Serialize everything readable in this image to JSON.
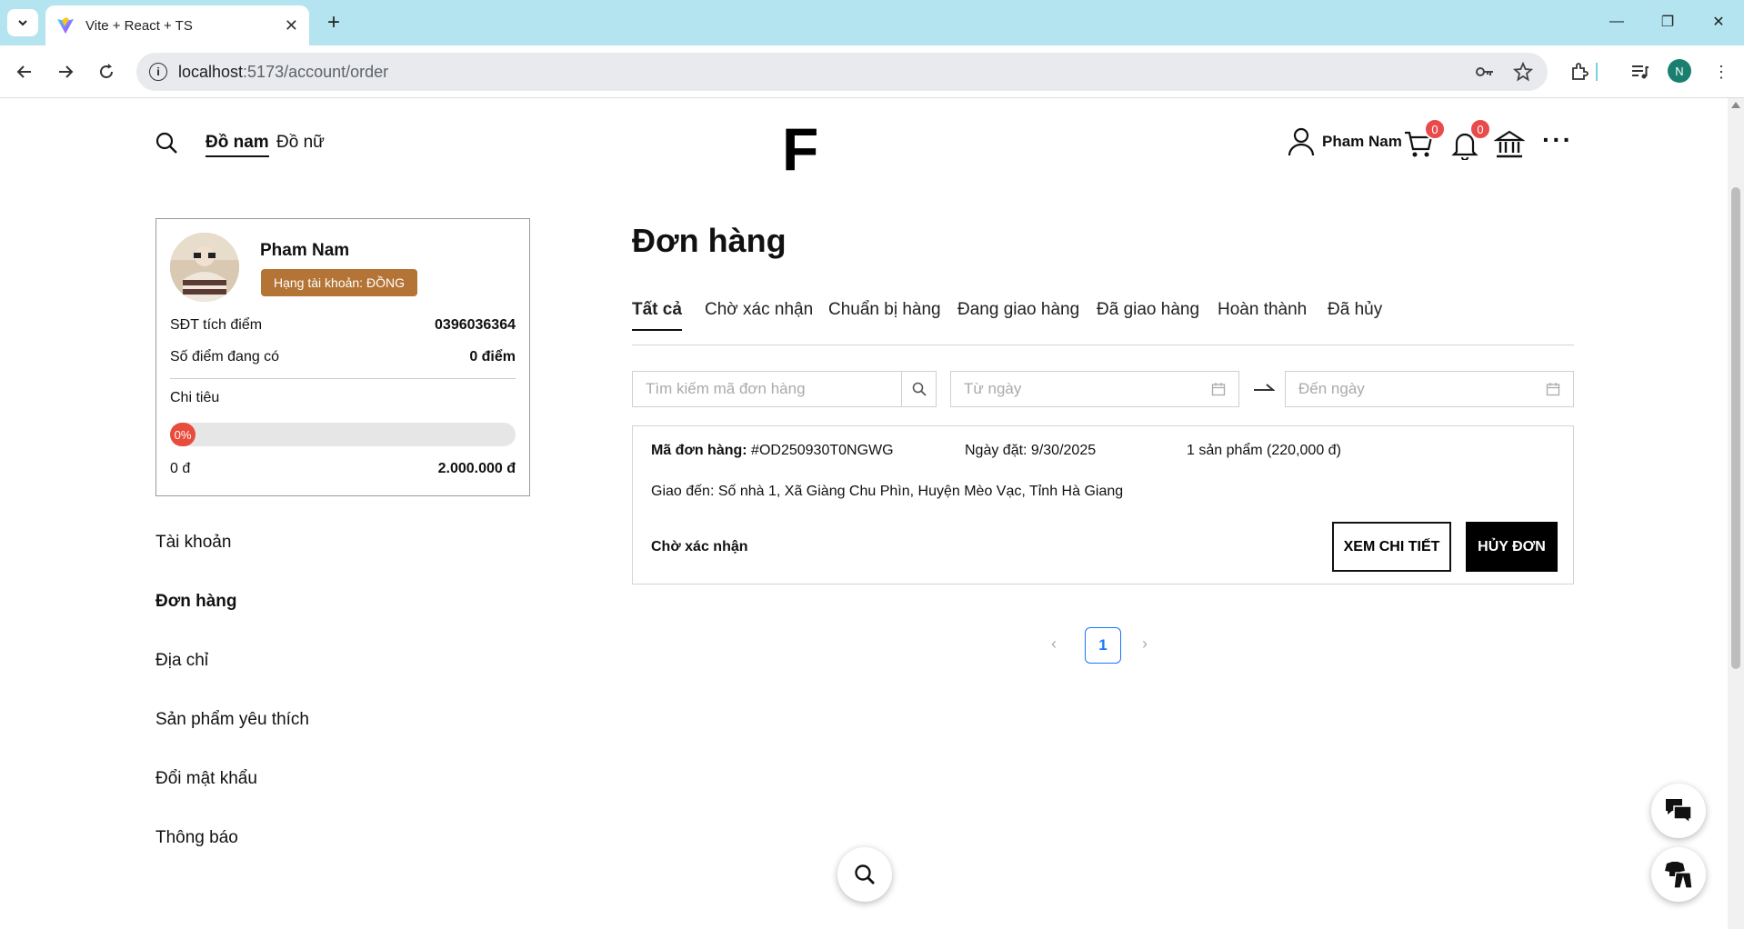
{
  "browser": {
    "tab_title": "Vite + React + TS",
    "url_host": "localhost",
    "url_path": ":5173/account/order",
    "profile_initial": "N"
  },
  "header": {
    "nav": [
      {
        "label": "Đồ nam",
        "active": true
      },
      {
        "label": "Đồ nữ",
        "active": false
      }
    ],
    "logo": "F",
    "user_name": "Pham Nam",
    "cart_count": "0",
    "notification_count": "0"
  },
  "profile_card": {
    "name": "Pham Nam",
    "rank": "Hạng tài khoản: ĐỒNG",
    "phone_label": "SĐT tích điểm",
    "phone_value": "0396036364",
    "points_label": "Số điểm đang có",
    "points_value": "0 điểm",
    "spending_label": "Chi tiêu",
    "progress_percent": 0,
    "progress_label": "0%",
    "spending_min": "0 đ",
    "spending_max": "2.000.000 đ"
  },
  "sidebar": {
    "items": [
      {
        "label": "Tài khoản",
        "active": false
      },
      {
        "label": "Đơn hàng",
        "active": true
      },
      {
        "label": "Địa chỉ",
        "active": false
      },
      {
        "label": "Sản phẩm yêu thích",
        "active": false
      },
      {
        "label": "Đổi mật khẩu",
        "active": false
      },
      {
        "label": "Thông báo",
        "active": false
      }
    ]
  },
  "main": {
    "title": "Đơn hàng",
    "tabs": [
      {
        "label": "Tất cả",
        "active": true
      },
      {
        "label": "Chờ xác nhận",
        "active": false
      },
      {
        "label": "Chuẩn bị hàng",
        "active": false
      },
      {
        "label": "Đang giao hàng",
        "active": false
      },
      {
        "label": "Đã giao hàng",
        "active": false
      },
      {
        "label": "Hoàn thành",
        "active": false
      },
      {
        "label": "Đã hủy",
        "active": false
      }
    ],
    "search_placeholder": "Tìm kiếm mã đơn hàng",
    "from_date_placeholder": "Từ ngày",
    "to_date_placeholder": "Đến ngày",
    "orders": [
      {
        "code_label": "Mã đơn hàng:",
        "code": "#OD250930T0NGWG",
        "date_text": "Ngày đặt: 9/30/2025",
        "products_text": "1 sản phẩm (220,000 đ)",
        "address_text": "Giao đến: Số nhà 1, Xã Giàng Chu Phìn, Huyện Mèo Vạc, Tỉnh Hà Giang",
        "status": "Chờ xác nhận",
        "detail_button": "XEM CHI TIẾT",
        "cancel_button": "HỦY ĐƠN"
      }
    ],
    "pagination": {
      "current": "1"
    }
  },
  "colors": {
    "accent_red": "#e94b4b",
    "rank_bronze": "#b47435",
    "page_active_blue": "#1677ff"
  }
}
